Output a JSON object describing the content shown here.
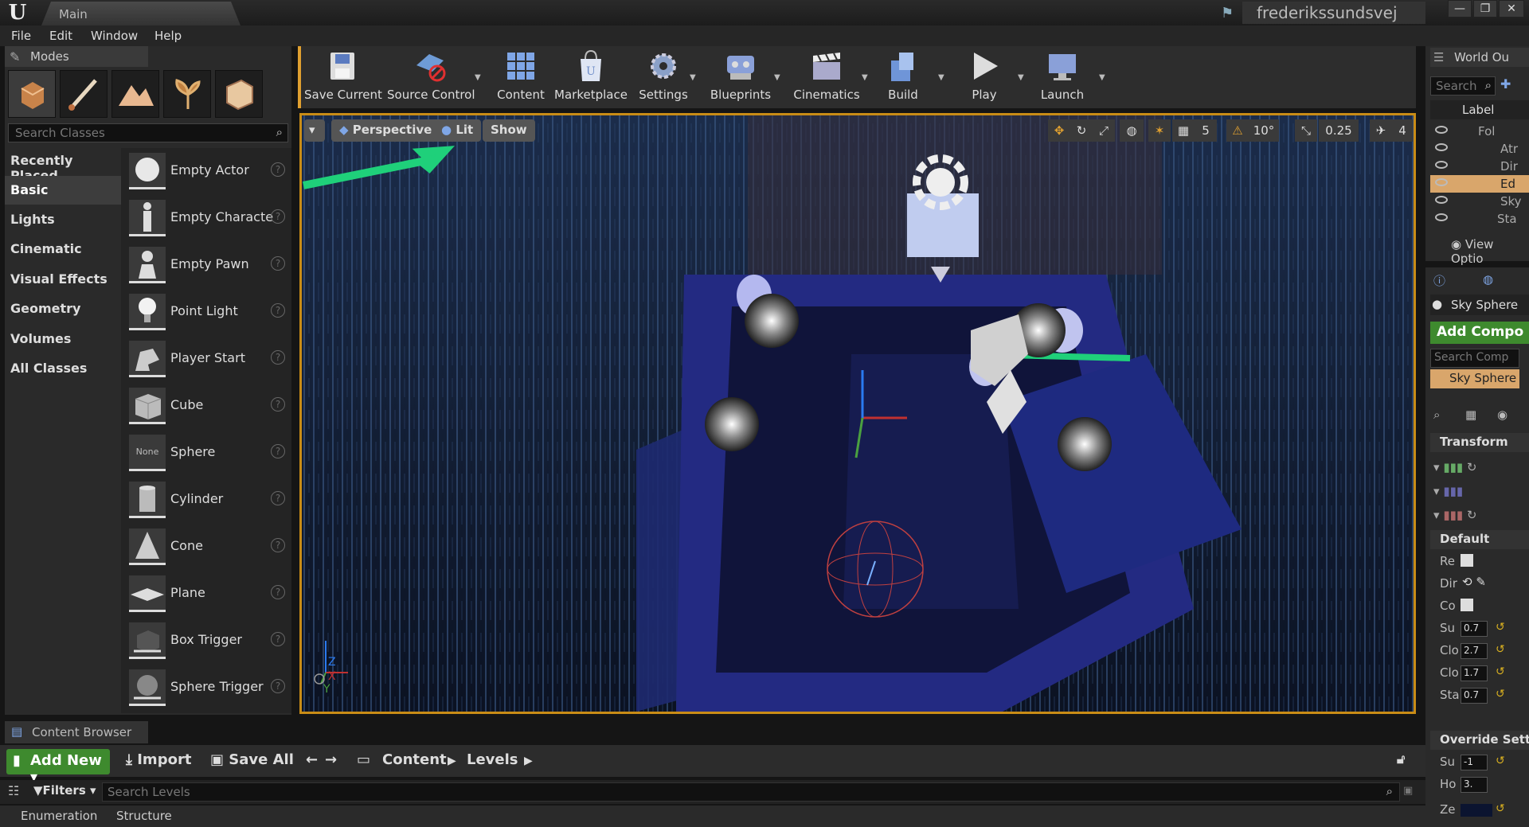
{
  "window": {
    "tab": "Main",
    "project": "frederikssundsvej",
    "logo": "U",
    "controls": [
      "—",
      "❐",
      "✕"
    ]
  },
  "menu": [
    "File",
    "Edit",
    "Window",
    "Help"
  ],
  "modes": {
    "tab": "Modes",
    "search_placeholder": "Search Classes",
    "categories": [
      "Recently Placed",
      "Basic",
      "Lights",
      "Cinematic",
      "Visual Effects",
      "Geometry",
      "Volumes",
      "All Classes"
    ],
    "active_category": "Basic",
    "classes": [
      "Empty Actor",
      "Empty Characte",
      "Empty Pawn",
      "Point Light",
      "Player Start",
      "Cube",
      "Sphere",
      "Cylinder",
      "Cone",
      "Plane",
      "Box Trigger",
      "Sphere Trigger"
    ],
    "sphere_thumb": "None"
  },
  "toolbar": {
    "save_current": "Save Current",
    "source_control": "Source Control",
    "content": "Content",
    "marketplace": "Marketplace",
    "settings": "Settings",
    "blueprints": "Blueprints",
    "cinematics": "Cinematics",
    "build": "Build",
    "play": "Play",
    "launch": "Launch"
  },
  "viewport": {
    "perspective": "Perspective",
    "lit": "Lit",
    "show": "Show",
    "grid_snap": "5",
    "rotation_snap": "10°",
    "scale_snap": "0.25",
    "camera_speed": "4",
    "axis_x": "X",
    "axis_y": "Y",
    "axis_z": "Z",
    "accent": "#c98c16"
  },
  "outliner": {
    "tab": "World Ou",
    "search_placeholder": "Search",
    "column": "Label",
    "rows": [
      "Fol",
      "Atr",
      "Dir",
      "Ed",
      "Sky",
      "Sta"
    ],
    "view_options": "View Optio"
  },
  "details": {
    "selected": "Sky Sphere",
    "add_component": "Add Compo",
    "search_placeholder": "Search Comp",
    "component": "Sky Sphere",
    "transform": "Transform",
    "default": "Default",
    "default_rows": [
      {
        "label": "Re",
        "value": ""
      },
      {
        "label": "Dir",
        "value": ""
      },
      {
        "label": "Co",
        "value": ""
      },
      {
        "label": "Su",
        "value": "0.7"
      },
      {
        "label": "Clo",
        "value": "2.7"
      },
      {
        "label": "Clo",
        "value": "1.7"
      },
      {
        "label": "Sta",
        "value": "0.7"
      }
    ],
    "override": "Override Settin",
    "override_rows": [
      {
        "label": "Su",
        "value": "-1"
      },
      {
        "label": "Ho",
        "value": "3."
      },
      {
        "label": "Ze",
        "value": ""
      }
    ]
  },
  "content_browser": {
    "tab": "Content Browser",
    "add_new": "Add New",
    "import": "Import",
    "save_all": "Save All",
    "path": [
      "Content",
      "Levels"
    ],
    "filters": "Filters",
    "search_placeholder": "Search Levels",
    "bottom_tabs": [
      "Enumeration",
      "Structure"
    ]
  }
}
